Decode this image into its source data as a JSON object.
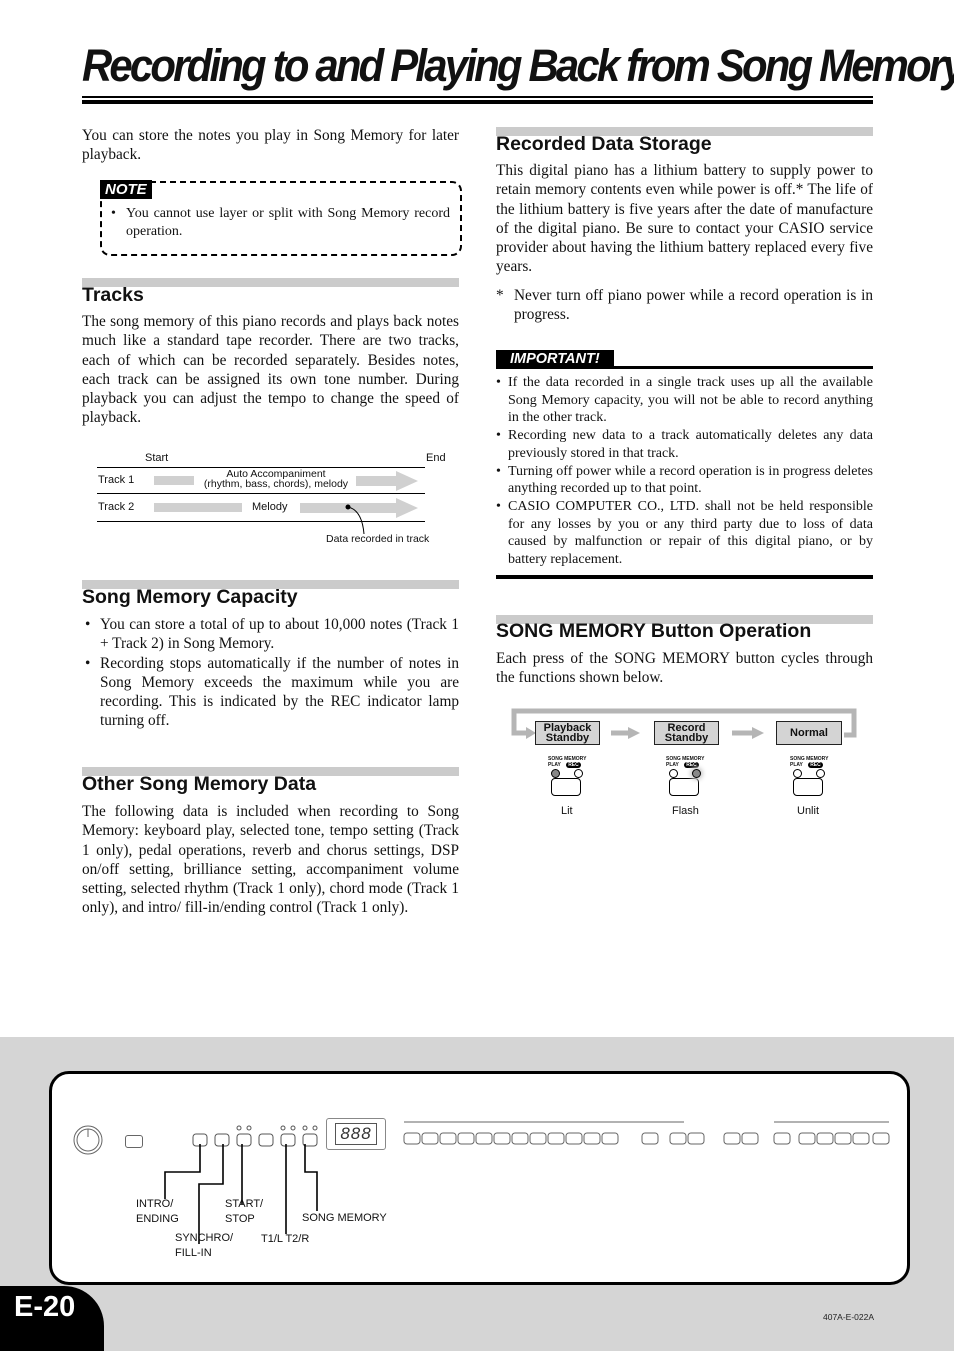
{
  "page": {
    "title": "Recording to and Playing Back from Song Memory",
    "page_number": "E-20",
    "doc_code": "407A-E-022A"
  },
  "intro": "You can store the notes you play in Song Memory for later playback.",
  "note": {
    "tag": "NOTE",
    "items": [
      "You cannot use layer or split with Song Memory record operation."
    ]
  },
  "tracks": {
    "heading": "Tracks",
    "body": "The song memory of this piano records and plays back notes much like a standard tape recorder. There are two tracks, each of which can be recorded separately. Besides notes, each track can be assigned its own tone number. During playback you can adjust the tempo to change the speed of playback.",
    "diagram": {
      "start": "Start",
      "end": "End",
      "track1_label": "Track 1",
      "track1_content_line1": "Auto Accompaniment",
      "track1_content_line2": "(rhythm, bass, chords), melody",
      "track2_label": "Track 2",
      "track2_content": "Melody",
      "callout": "Data recorded in track"
    }
  },
  "capacity": {
    "heading": "Song Memory Capacity",
    "items": [
      "You can store a total of up to about 10,000 notes (Track 1 + Track 2) in Song Memory.",
      "Recording stops automatically if the number of notes in Song Memory exceeds the maximum while you are recording. This is indicated by the REC indicator lamp turning off."
    ]
  },
  "other": {
    "heading": "Other Song Memory Data",
    "body": "The following data is included when recording to Song Memory: keyboard play, selected tone, tempo setting (Track 1 only), pedal operations, reverb and chorus settings, DSP on/off setting, brilliance setting, accompaniment volume setting, selected rhythm (Track 1 only), chord mode (Track 1 only), and intro/ fill-in/ending control (Track 1 only)."
  },
  "storage": {
    "heading": "Recorded Data Storage",
    "body": "This digital piano has a lithium battery to supply power to retain memory contents even while power is off.* The life of the lithium battery is five years after the date of manufacture of the digital piano. Be sure to contact your CASIO service provider about having the lithium battery replaced every five years.",
    "footnote_mark": "*",
    "footnote": "Never turn off piano power while a record operation is in progress."
  },
  "important": {
    "tag": "IMPORTANT!",
    "items": [
      "If the data recorded in a single track uses up all the available Song Memory capacity, you will not be able to record anything in the other track.",
      "Recording new data to a track automatically deletes any data previously stored in that track.",
      "Turning off power while a record operation is in progress deletes anything recorded up to that point.",
      "CASIO COMPUTER CO., LTD. shall not be held responsible for any losses by you or any third party due to loss of data caused by malfunction or repair of this digital piano, or by battery replacement."
    ]
  },
  "button_op": {
    "heading": "SONG MEMORY Button Operation",
    "body": "Each press of the SONG MEMORY button cycles through the functions shown below.",
    "panel_label": "SONG MEMORY",
    "play_label": "PLAY",
    "rec_label": "REC",
    "states": [
      {
        "line1": "Playback",
        "line2": "Standby",
        "lamp": "Lit"
      },
      {
        "line1": "Record",
        "line2": "Standby",
        "lamp": "Flash"
      },
      {
        "line1": "Normal",
        "line2": "",
        "lamp": "Unlit"
      }
    ]
  },
  "control_panel": {
    "display": "888",
    "callouts": {
      "intro": [
        "INTRO/",
        "ENDING"
      ],
      "synchro": [
        "SYNCHRO/",
        "FILL-IN"
      ],
      "start": [
        "START/",
        "STOP"
      ],
      "t1t2": "T1/L T2/R",
      "song_memory": "SONG MEMORY"
    }
  }
}
